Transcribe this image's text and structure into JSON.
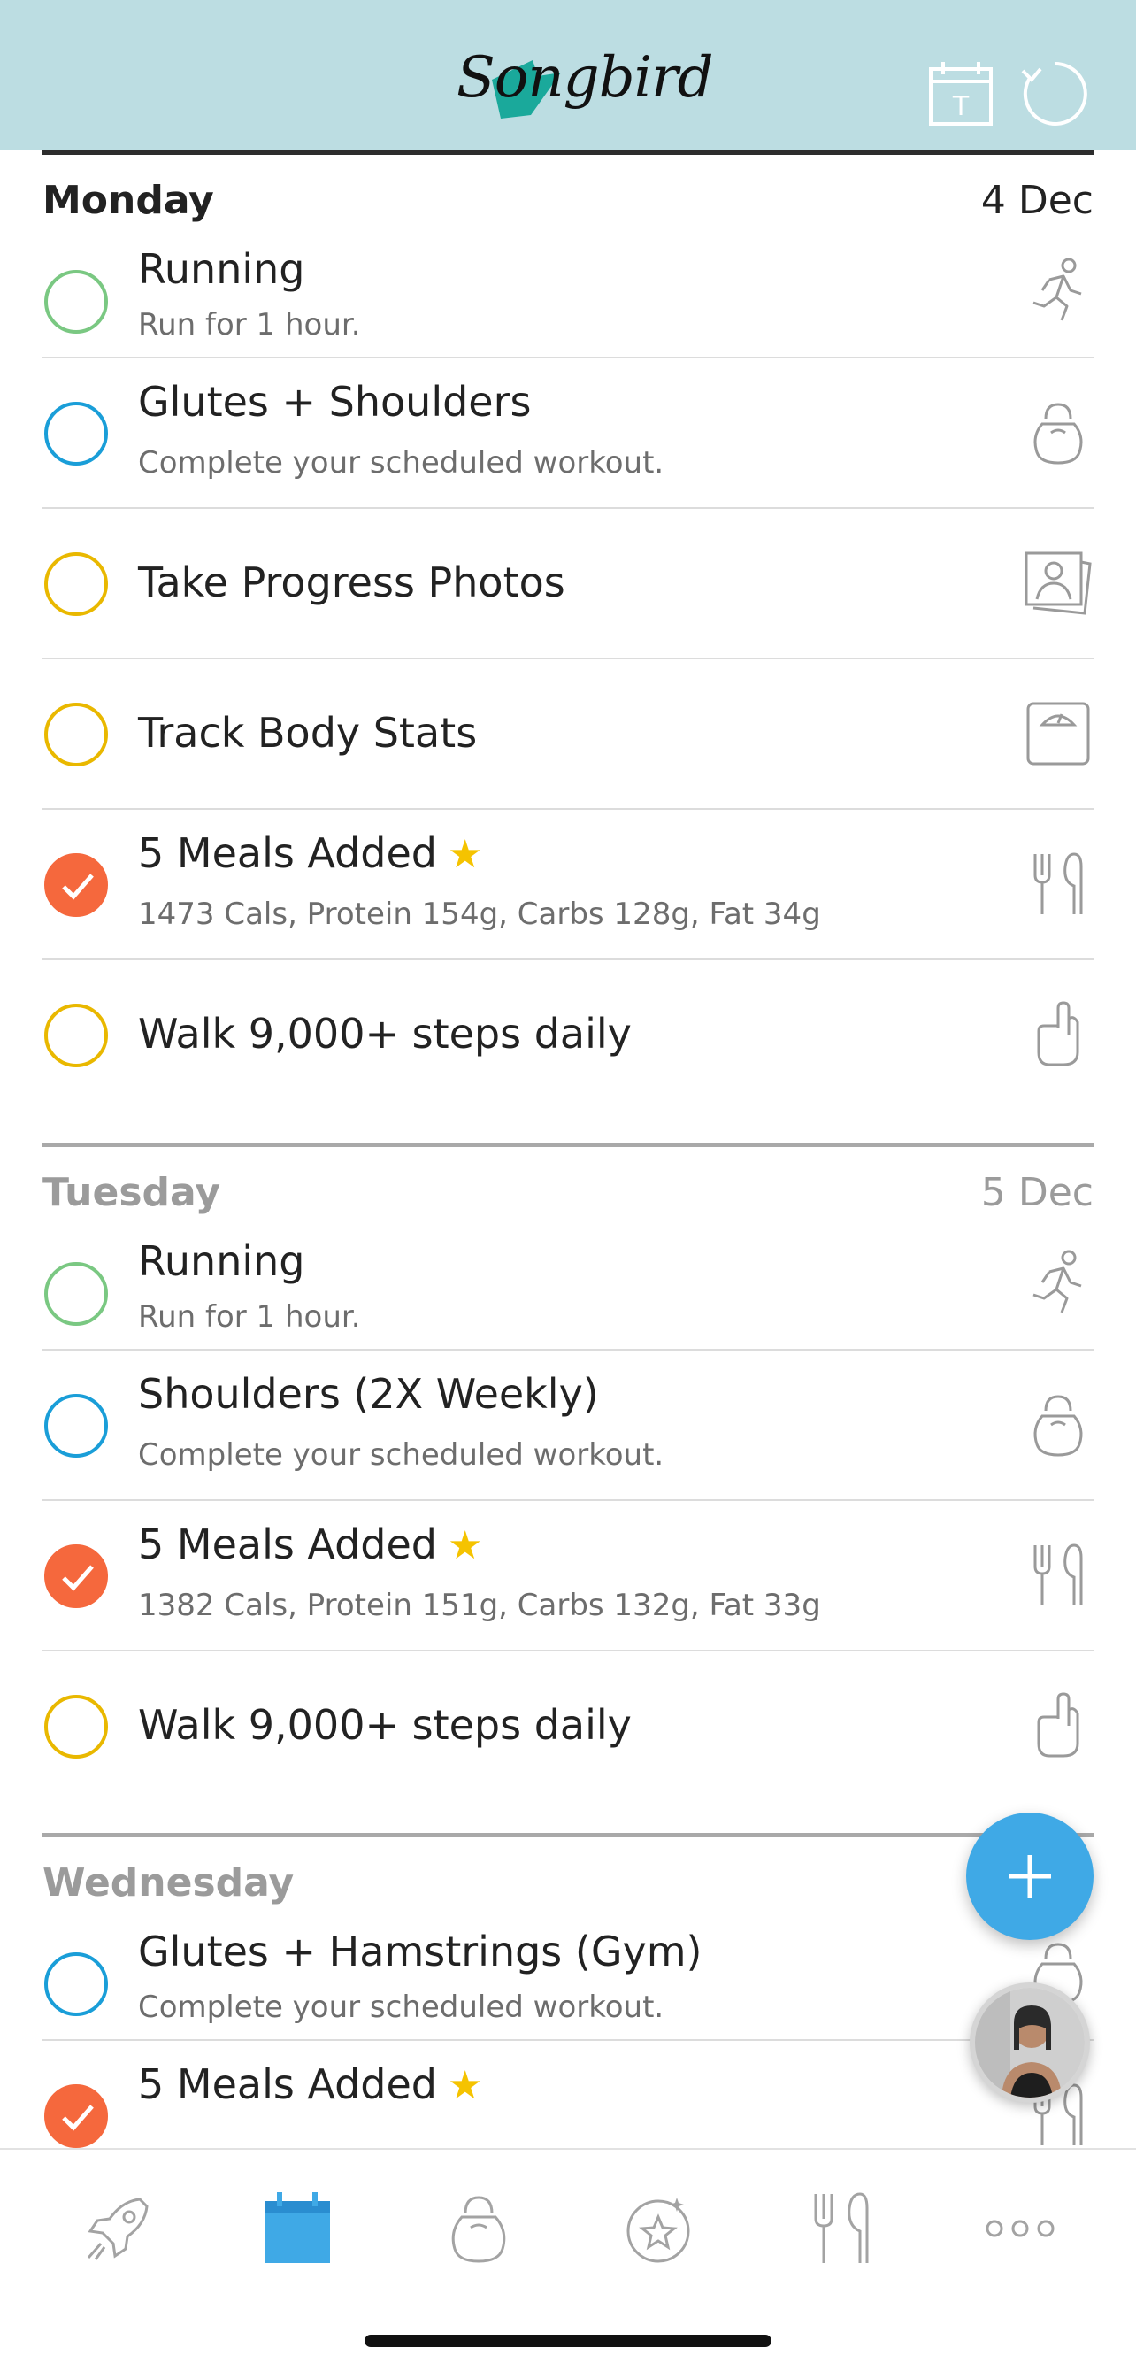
{
  "app": {
    "logo_text": "Songbird"
  },
  "colors": {
    "header_bg": "#bcdde2",
    "done": "#f5683d",
    "fab": "#3fa9e6",
    "green": "#7ac882",
    "blue": "#1a9ed8",
    "yellow": "#e9b800",
    "star": "#f5c300"
  },
  "header": {
    "calendar_icon": "calendar-today-icon",
    "calendar_letter": "T",
    "sync_icon": "refresh-icon"
  },
  "days": [
    {
      "name": "Monday",
      "date": "4 Dec",
      "tasks": [
        {
          "title": "Running",
          "subtitle": "Run for 1 hour.",
          "status": "open",
          "color": "green",
          "icon": "runner-icon"
        },
        {
          "title": "Glutes + Shoulders",
          "subtitle": "Complete your scheduled workout.",
          "status": "open",
          "color": "blue",
          "icon": "kettlebell-icon"
        },
        {
          "title": "Take Progress Photos",
          "status": "open",
          "color": "yellow",
          "icon": "photos-icon"
        },
        {
          "title": "Track Body Stats",
          "status": "open",
          "color": "yellow",
          "icon": "scale-icon"
        },
        {
          "title": "5 Meals Added",
          "subtitle": "1473 Cals, Protein 154g, Carbs 128g, Fat 34g",
          "status": "done",
          "starred": true,
          "icon": "fork-knife-icon"
        },
        {
          "title": "Walk 9,000+ steps daily",
          "status": "open",
          "color": "yellow",
          "icon": "hand-icon"
        }
      ]
    },
    {
      "name": "Tuesday",
      "date": "5 Dec",
      "tasks": [
        {
          "title": "Running",
          "subtitle": "Run for 1 hour.",
          "status": "open",
          "color": "green",
          "icon": "runner-icon"
        },
        {
          "title": "Shoulders (2X Weekly)",
          "subtitle": "Complete your scheduled workout.",
          "status": "open",
          "color": "blue",
          "icon": "kettlebell-icon"
        },
        {
          "title": "5 Meals Added",
          "subtitle": "1382 Cals, Protein 151g, Carbs 132g, Fat 33g",
          "status": "done",
          "starred": true,
          "icon": "fork-knife-icon"
        },
        {
          "title": "Walk 9,000+ steps daily",
          "status": "open",
          "color": "yellow",
          "icon": "hand-icon"
        }
      ]
    },
    {
      "name": "Wednesday",
      "date": "",
      "tasks": [
        {
          "title": "Glutes + Hamstrings (Gym)",
          "subtitle": "Complete your scheduled workout.",
          "status": "open",
          "color": "blue",
          "icon": "kettlebell-icon"
        },
        {
          "title": "5 Meals Added",
          "subtitle": "",
          "status": "done",
          "starred": true,
          "icon": "fork-knife-icon"
        }
      ]
    }
  ],
  "fab": {
    "icon": "plus-icon"
  },
  "tabbar": [
    {
      "name": "rocket-icon"
    },
    {
      "name": "calendar-icon",
      "active": true
    },
    {
      "name": "kettlebell-icon"
    },
    {
      "name": "star-badge-icon"
    },
    {
      "name": "fork-knife-icon"
    },
    {
      "name": "more-icon"
    }
  ]
}
